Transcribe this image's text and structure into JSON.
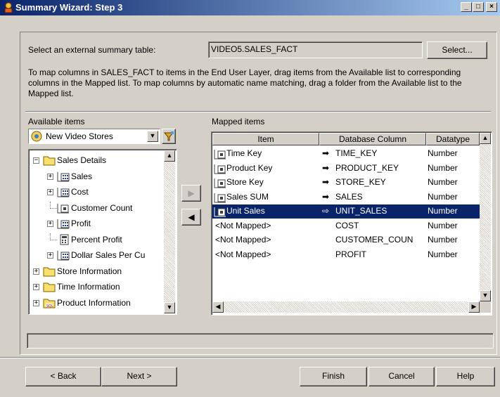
{
  "window": {
    "title": "Summary Wizard: Step 3",
    "controls": {
      "minimize": "_",
      "maximize": "□",
      "close": "×"
    }
  },
  "summary_table": {
    "label": "Select an external summary table:",
    "value": "VIDEO5.SALES_FACT",
    "select_button": "Select..."
  },
  "instructions": "To map columns in SALES_FACT to items in the End User Layer, drag items from the Available list to corresponding columns in the Mapped list. To map columns by automatic name matching, drag a folder from the Available list to the Mapped list.",
  "available": {
    "label": "Available items",
    "business_area": "New Video Stores",
    "tree": [
      {
        "label": "Sales Details",
        "expander": "−",
        "icon": "folder-icon"
      },
      {
        "label": "Sales",
        "expander": "+",
        "icon": "item-class-icon"
      },
      {
        "label": "Cost",
        "expander": "+",
        "icon": "item-class-icon"
      },
      {
        "label": "Customer Count",
        "expander": "",
        "icon": "item-icon"
      },
      {
        "label": "Profit",
        "expander": "+",
        "icon": "item-class-icon"
      },
      {
        "label": "Percent Profit",
        "expander": "",
        "icon": "calc-item-icon"
      },
      {
        "label": "Dollar Sales Per Cu",
        "expander": "+",
        "icon": "item-class-icon"
      },
      {
        "label": "Store Information",
        "expander": "+",
        "icon": "folder-icon"
      },
      {
        "label": "Time Information",
        "expander": "+",
        "icon": "folder-icon"
      },
      {
        "label": "Product Information",
        "expander": "+",
        "icon": "sql-folder-icon"
      }
    ]
  },
  "move_buttons": {
    "add": "▶",
    "remove": "◀"
  },
  "mapped": {
    "label": "Mapped items",
    "columns": [
      "Item",
      "Database Column",
      "Datatype"
    ],
    "rows": [
      {
        "item": "Time Key",
        "arrow": "➡",
        "column": "TIME_KEY",
        "datatype": "Number",
        "mapped": true
      },
      {
        "item": "Product Key",
        "arrow": "➡",
        "column": "PRODUCT_KEY",
        "datatype": "Number",
        "mapped": true
      },
      {
        "item": "Store Key",
        "arrow": "➡",
        "column": "STORE_KEY",
        "datatype": "Number",
        "mapped": true
      },
      {
        "item": "Sales SUM",
        "arrow": "➡",
        "column": "SALES",
        "datatype": "Number",
        "mapped": true
      },
      {
        "item": "Unit Sales",
        "arrow": "⇨",
        "column": "UNIT_SALES",
        "datatype": "Number",
        "mapped": true
      },
      {
        "item": "<Not Mapped>",
        "arrow": "",
        "column": "COST",
        "datatype": "Number",
        "mapped": false
      },
      {
        "item": "<Not Mapped>",
        "arrow": "",
        "column": "CUSTOMER_COUN",
        "datatype": "Number",
        "mapped": false
      },
      {
        "item": "<Not Mapped>",
        "arrow": "",
        "column": "PROFIT",
        "datatype": "Number",
        "mapped": false
      }
    ],
    "selected_row": 4
  },
  "footer": {
    "back": "< Back",
    "next": "Next >",
    "finish": "Finish",
    "cancel": "Cancel",
    "help": "Help"
  },
  "colors": {
    "selection": "#0a246a",
    "face": "#d4d0c8",
    "title_start": "#0a246a",
    "title_end": "#a6caf0"
  }
}
